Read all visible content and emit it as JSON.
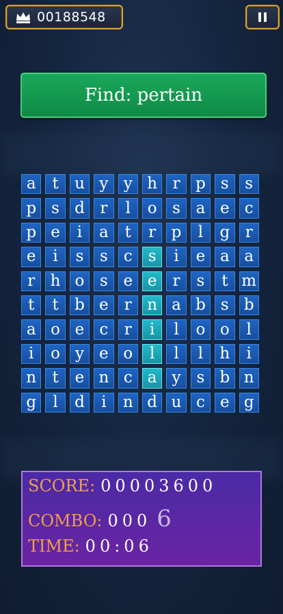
{
  "top_bar": {
    "score": "00188548",
    "crown_icon": "crown-icon",
    "pause_icon": "pause-icon"
  },
  "banner": {
    "text": "Find: pertain"
  },
  "grid": {
    "rows": [
      [
        "a",
        "t",
        "u",
        "y",
        "y",
        "h",
        "r",
        "p",
        "s",
        "s"
      ],
      [
        "p",
        "s",
        "d",
        "r",
        "l",
        "o",
        "s",
        "a",
        "e",
        "c"
      ],
      [
        "p",
        "e",
        "i",
        "a",
        "t",
        "r",
        "p",
        "l",
        "g",
        "r"
      ],
      [
        "e",
        "i",
        "s",
        "s",
        "c",
        "s",
        "i",
        "e",
        "a",
        "a"
      ],
      [
        "r",
        "h",
        "o",
        "s",
        "e",
        "e",
        "r",
        "s",
        "t",
        "m"
      ],
      [
        "t",
        "t",
        "b",
        "e",
        "r",
        "n",
        "a",
        "b",
        "s",
        "b"
      ],
      [
        "a",
        "o",
        "e",
        "c",
        "r",
        "i",
        "l",
        "o",
        "o",
        "l"
      ],
      [
        "i",
        "o",
        "y",
        "e",
        "o",
        "l",
        "l",
        "l",
        "h",
        "i"
      ],
      [
        "n",
        "t",
        "e",
        "n",
        "c",
        "a",
        "y",
        "s",
        "b",
        "n"
      ],
      [
        "g",
        "l",
        "d",
        "i",
        "n",
        "d",
        "u",
        "c",
        "e",
        "g"
      ]
    ],
    "selected": [
      [
        3,
        5
      ],
      [
        4,
        5
      ],
      [
        5,
        5
      ],
      [
        6,
        5
      ],
      [
        7,
        5
      ],
      [
        8,
        5
      ]
    ],
    "colors": {
      "cell": "#1f64c2",
      "selected": "#23b8c8"
    }
  },
  "stats": {
    "score_label": "SCORE:",
    "score_value": "00003600",
    "combo_label": "COMBO:",
    "combo_value": "000",
    "combo_last": "6",
    "time_label": "TIME:",
    "time_value": "00:06"
  }
}
